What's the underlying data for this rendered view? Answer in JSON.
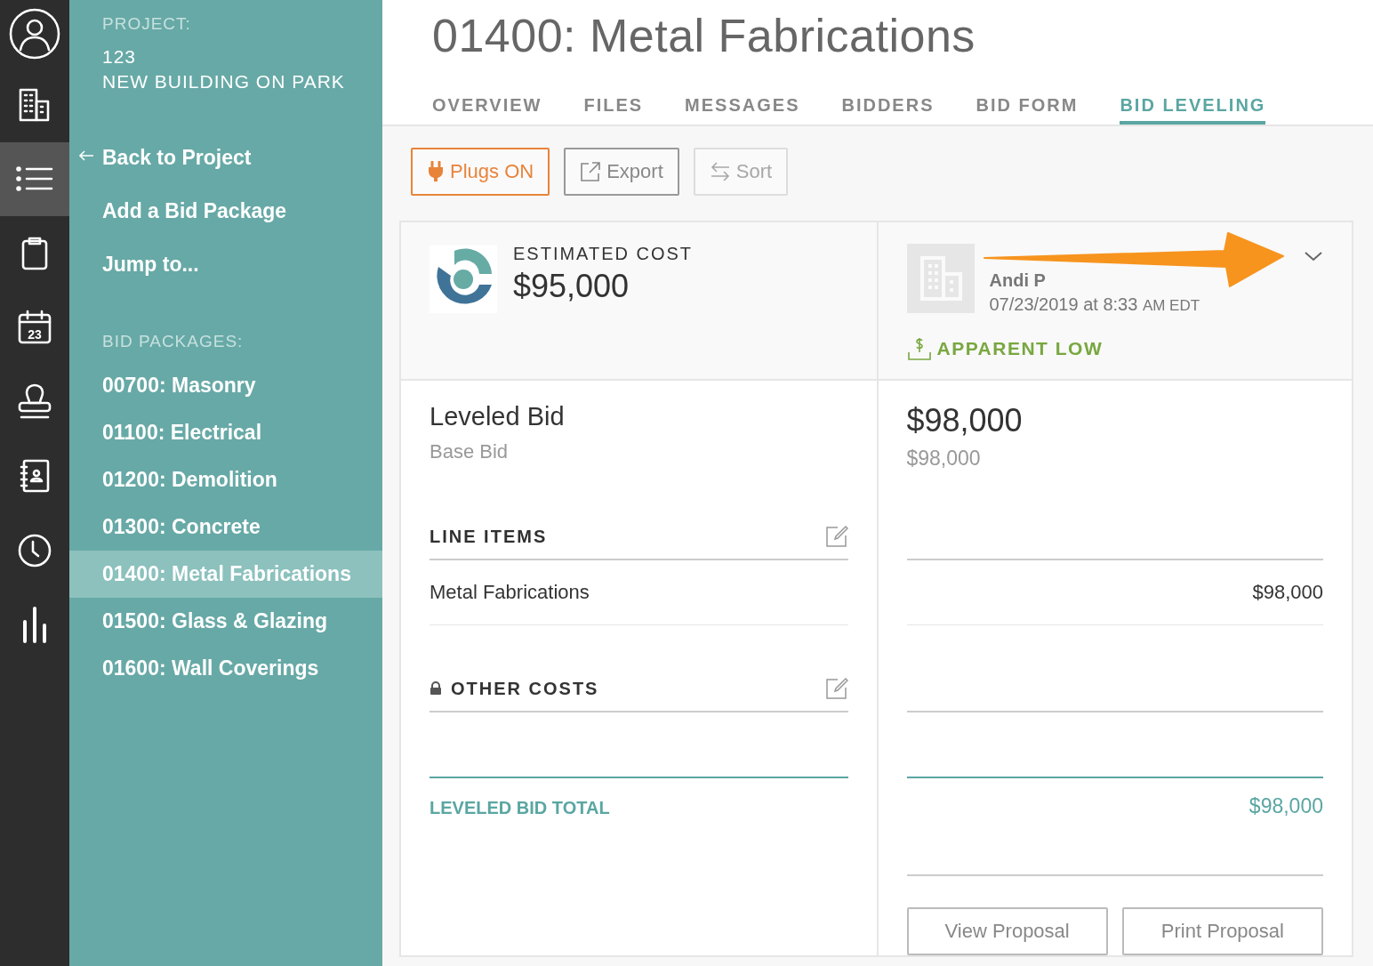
{
  "nav_rail": [
    {
      "kind": "user",
      "selected": false
    },
    {
      "kind": "building",
      "selected": false
    },
    {
      "kind": "list",
      "selected": true
    },
    {
      "kind": "clipboard",
      "selected": false
    },
    {
      "kind": "calendar",
      "selected": false,
      "badge": "23"
    },
    {
      "kind": "stamp",
      "selected": false
    },
    {
      "kind": "contacts",
      "selected": false
    },
    {
      "kind": "clock",
      "selected": false
    },
    {
      "kind": "chart",
      "selected": false
    }
  ],
  "sidebar": {
    "project_label": "PROJECT:",
    "project_number": "123",
    "project_name": "NEW BUILDING ON PARK",
    "links": [
      {
        "kind": "back",
        "label": "Back to Project"
      },
      {
        "kind": "plain",
        "label": "Add a Bid Package"
      },
      {
        "kind": "plain",
        "label": "Jump to..."
      }
    ],
    "packages_label": "BID PACKAGES:",
    "packages": [
      {
        "label": "00700: Masonry",
        "selected": false
      },
      {
        "label": "01100: Electrical",
        "selected": false
      },
      {
        "label": "01200: Demolition",
        "selected": false
      },
      {
        "label": "01300: Concrete",
        "selected": false
      },
      {
        "label": "01400: Metal Fabrications",
        "selected": true
      },
      {
        "label": "01500: Glass & Glazing",
        "selected": false
      },
      {
        "label": "01600: Wall Coverings",
        "selected": false
      }
    ]
  },
  "title": "01400: Metal Fabrications",
  "tabs": [
    {
      "label": "OVERVIEW",
      "selected": false
    },
    {
      "label": "FILES",
      "selected": false
    },
    {
      "label": "MESSAGES",
      "selected": false
    },
    {
      "label": "BIDDERS",
      "selected": false
    },
    {
      "label": "BID FORM",
      "selected": false
    },
    {
      "label": "BID LEVELING",
      "selected": true
    }
  ],
  "toolbar": [
    {
      "kind": "plugs",
      "label": "Plugs ON",
      "on": true,
      "disabled": false
    },
    {
      "kind": "export",
      "label": "Export",
      "disabled": false
    },
    {
      "kind": "sort",
      "label": "Sort",
      "disabled": true
    }
  ],
  "estimate": {
    "label": "ESTIMATED COST",
    "amount": "$95,000"
  },
  "bidder": {
    "contact": "Andi P",
    "date": "07/23/2019 at 8:33",
    "time_suffix": "AM EDT",
    "badge": "APPARENT LOW"
  },
  "leveled": {
    "title": "Leveled Bid",
    "subtitle": "Base Bid",
    "bid_amount": "$98,000",
    "bid_base": "$98,000",
    "sections": [
      {
        "title": "LINE ITEMS",
        "locked": false,
        "rows": [
          {
            "name": "Metal Fabrications",
            "amount": "$98,000"
          }
        ]
      },
      {
        "title": "OTHER COSTS",
        "locked": true
      }
    ],
    "total_label": "LEVELED BID TOTAL",
    "total_amount": "$98,000",
    "buttons": [
      "View Proposal",
      "Print Proposal"
    ]
  }
}
